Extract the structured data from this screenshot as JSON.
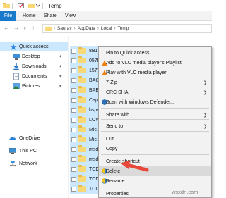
{
  "window": {
    "title": "Temp"
  },
  "ribbon": {
    "file": "File",
    "home": "Home",
    "share": "Share",
    "view": "View"
  },
  "address": {
    "back_icon": "back-arrow-icon",
    "forward_icon": "forward-arrow-icon",
    "up_icon": "up-arrow-icon",
    "crumbs": [
      "Saurav",
      "AppData",
      "Local",
      "Temp"
    ]
  },
  "nav": {
    "quick_access": "Quick access",
    "desktop": "Desktop",
    "downloads": "Downloads",
    "documents": "Documents",
    "pictures": "Pictures",
    "onedrive": "OneDrive",
    "this_pc": "This PC",
    "network": "Network"
  },
  "files": [
    "8B1E0...",
    "057F...",
    "1577...",
    "BACF...",
    "BABE...",
    "Cap...",
    "hsper...",
    "LOW...",
    "Mic...",
    "Mic...",
    "msd...",
    "msd...",
    "TCD...",
    "TCD...",
    "TCD..."
  ],
  "menu": {
    "items": [
      {
        "label": "Pin to Quick access",
        "icon": "",
        "arrow": false
      },
      {
        "label": "Add to VLC media player's Playlist",
        "icon": "vlc-icon",
        "arrow": false
      },
      {
        "label": "Play with VLC media player",
        "icon": "vlc-icon",
        "arrow": false
      },
      {
        "label": "7-Zip",
        "icon": "",
        "arrow": true
      },
      {
        "label": "CRC SHA",
        "icon": "",
        "arrow": true
      },
      {
        "label": "Scan with Windows Defender...",
        "icon": "defender-icon",
        "arrow": false
      },
      {
        "label": "Share with",
        "icon": "",
        "arrow": true
      },
      {
        "label": "Send to",
        "icon": "",
        "arrow": true
      },
      {
        "label": "Cut",
        "icon": "",
        "arrow": false
      },
      {
        "label": "Copy",
        "icon": "",
        "arrow": false
      },
      {
        "label": "Create shortcut",
        "icon": "",
        "arrow": false
      },
      {
        "label": "Delete",
        "icon": "shield-icon",
        "arrow": false
      },
      {
        "label": "Rename",
        "icon": "shield-icon",
        "arrow": false
      },
      {
        "label": "Properties",
        "icon": "",
        "arrow": false
      }
    ]
  },
  "watermark": "wsxdn.com",
  "colors": {
    "file_tab": "#1979ca",
    "selection": "#cce8ff",
    "arrow": "#e8483a",
    "folder": "#f8d775"
  }
}
